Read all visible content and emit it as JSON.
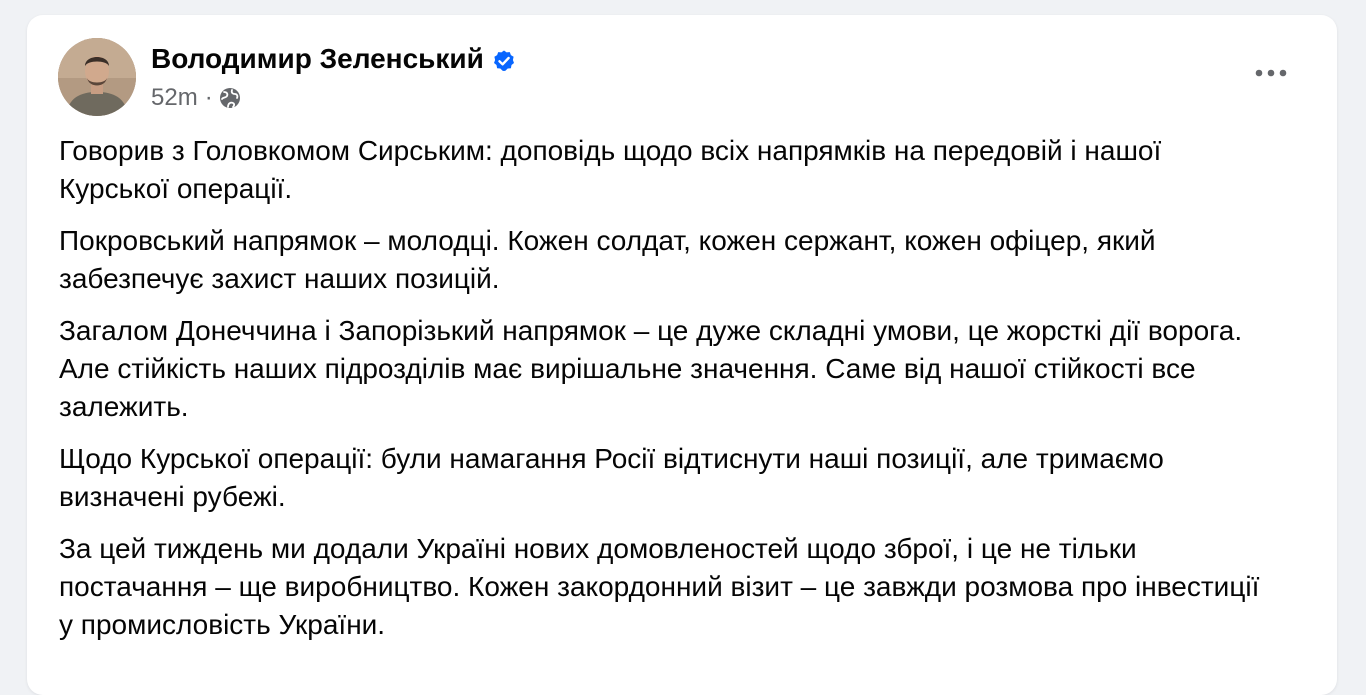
{
  "post": {
    "author": "Володимир Зеленський",
    "time": "52m",
    "separator": "·",
    "verified_icon": "verified-badge-icon",
    "privacy_icon": "globe-icon",
    "more_icon": "more-options-icon",
    "paragraphs": [
      "Говорив з Головкомом Сирським: доповідь щодо всіх напрямків на передовій і нашої Курської операції.",
      "Покровський напрямок – молодці. Кожен солдат, кожен сержант, кожен офіцер, який забезпечує захист наших позицій.",
      "Загалом Донеччина і Запорізький напрямок – це дуже складні умови, це жорсткі дії ворога. Але стійкість наших підрозділів має вирішальне значення. Саме від нашої стійкості все залежить.",
      "Щодо Курської операції: були намагання Росії відтиснути наші позиції, але тримаємо визначені рубежі.",
      "За цей тиждень ми додали Україні нових домовленостей щодо зброї, і це не тільки постачання – ще виробництво. Кожен закордонний візит – це завжди розмова про інвестиції у промисловість України."
    ]
  },
  "colors": {
    "background": "#f0f2f5",
    "card": "#ffffff",
    "text": "#050505",
    "secondary_text": "#65676b",
    "verified_blue": "#0866ff"
  }
}
